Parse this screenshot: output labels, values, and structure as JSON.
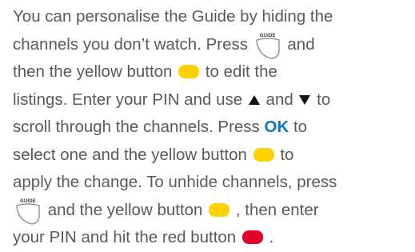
{
  "instructions": {
    "line1": "You can personalise the Guide by hiding the",
    "line2_a": "channels you don’t watch. Press",
    "line2_b": "and",
    "line3_a": "then the yellow button",
    "line3_b": "to edit the",
    "line4_a": "listings. Enter your PIN and use",
    "line4_b": "and",
    "line4_c": "to",
    "line5_a": "scroll through the channels. Press",
    "line5_b": "to",
    "line6_a": "select one and the yellow button",
    "line6_b": "to",
    "line7": "apply the change. To unhide channels, press",
    "line8_a": "and the yellow button",
    "line8_b": ", then enter",
    "line9_a": "your PIN and hit the red button",
    "line9_b": "."
  },
  "keys": {
    "guide_label": "GUIDE",
    "ok_label": "OK"
  },
  "colors": {
    "text": "#5a5a5a",
    "yellow_button": "#ffd100",
    "red_button": "#e4002b",
    "ok_key": "#0d76c7"
  },
  "icons": {
    "guide_key": "guide-remote-key-icon",
    "up_arrow": "up-triangle-icon",
    "down_arrow": "down-triangle-icon",
    "yellow_button": "yellow-button-icon",
    "red_button": "red-button-icon"
  }
}
